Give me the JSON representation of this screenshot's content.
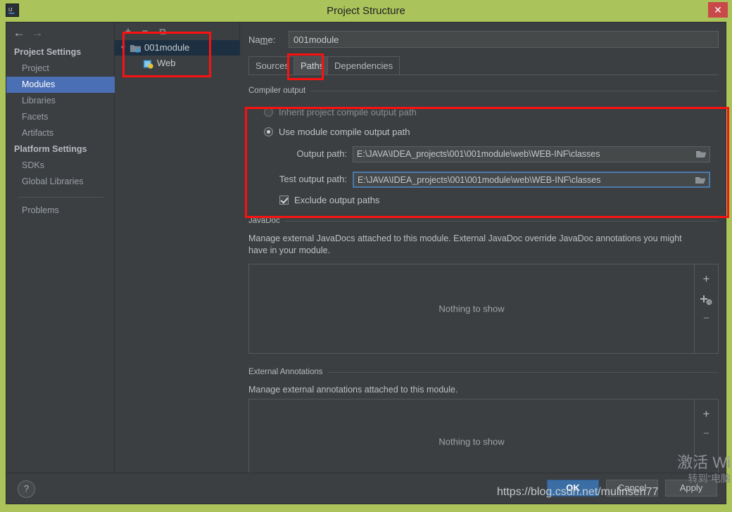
{
  "window": {
    "title": "Project Structure",
    "logo_icon": "intellij-idea-logo-icon",
    "close_label": "✕"
  },
  "nav": {
    "back_icon": "←",
    "forward_icon": "→"
  },
  "sidebar": {
    "groups": [
      {
        "label": "Project Settings"
      },
      {
        "label": "Platform Settings"
      }
    ],
    "items": [
      {
        "label": "Project",
        "selected": false
      },
      {
        "label": "Modules",
        "selected": true
      },
      {
        "label": "Libraries",
        "selected": false
      },
      {
        "label": "Facets",
        "selected": false
      },
      {
        "label": "Artifacts",
        "selected": false
      },
      {
        "label": "SDKs",
        "selected": false
      },
      {
        "label": "Global Libraries",
        "selected": false
      },
      {
        "label": "Problems",
        "selected": false
      }
    ]
  },
  "tree": {
    "toolbar": [
      {
        "label": "+",
        "name": "add-module-button"
      },
      {
        "label": "−",
        "name": "remove-module-button"
      },
      {
        "label": "⧉",
        "name": "copy-module-button"
      }
    ],
    "nodes": [
      {
        "label": "001module",
        "icon": "module-folder-icon",
        "selected": true,
        "expanded": true
      },
      {
        "label": "Web",
        "icon": "web-facet-icon",
        "selected": false
      }
    ]
  },
  "main": {
    "name_label": "Name:",
    "name_value": "001module",
    "tabs": [
      {
        "label": "Sources",
        "active": false
      },
      {
        "label": "Paths",
        "active": true
      },
      {
        "label": "Dependencies",
        "active": false
      }
    ],
    "compiler_output": {
      "title": "Compiler output",
      "inherit_option": "Inherit project compile output path",
      "module_option": "Use module compile output path",
      "selected_option": "module",
      "output_path_label": "Output path:",
      "output_path_value": "E:\\JAVA\\IDEA_projects\\001\\001module\\web\\WEB-INF\\classes",
      "test_output_path_label": "Test output path:",
      "test_output_path_value": "E:\\JAVA\\IDEA_projects\\001\\001module\\web\\WEB-INF\\classes",
      "exclude_label": "Exclude output paths",
      "exclude_checked": true,
      "browse_icon": "folder-browse-icon"
    },
    "javadoc": {
      "title": "JavaDoc",
      "description": "Manage external JavaDocs attached to this module. External JavaDoc override JavaDoc annotations you might have in your module.",
      "empty_text": "Nothing to show",
      "buttons": [
        {
          "label": "+",
          "name": "javadoc-add-button"
        },
        {
          "label": "+",
          "name": "javadoc-add-url-button"
        },
        {
          "label": "−",
          "name": "javadoc-remove-button"
        }
      ]
    },
    "external_annotations": {
      "title": "External Annotations",
      "description": "Manage external annotations attached to this module.",
      "empty_text": "Nothing to show",
      "buttons": [
        {
          "label": "+",
          "name": "annotations-add-button"
        },
        {
          "label": "−",
          "name": "annotations-remove-button"
        }
      ]
    }
  },
  "footer": {
    "help_label": "?",
    "ok_label": "OK",
    "cancel_label": "Cancel",
    "apply_label": "Apply"
  },
  "watermark": {
    "activate_line1": "激活 Wi",
    "activate_line2": "转到“电脑",
    "blog_url": "https://blog.csdn.net/mulinsen77"
  },
  "colors": {
    "window_frame": "#aac35a",
    "dialog_bg": "#3c3f41",
    "selection_blue": "#4a6fb5",
    "tree_selection": "#1c3042",
    "primary_button": "#3a6ea5",
    "close_button": "#c9484a",
    "annotation_red": "#fb1111",
    "focus_border": "#4a7aab"
  }
}
